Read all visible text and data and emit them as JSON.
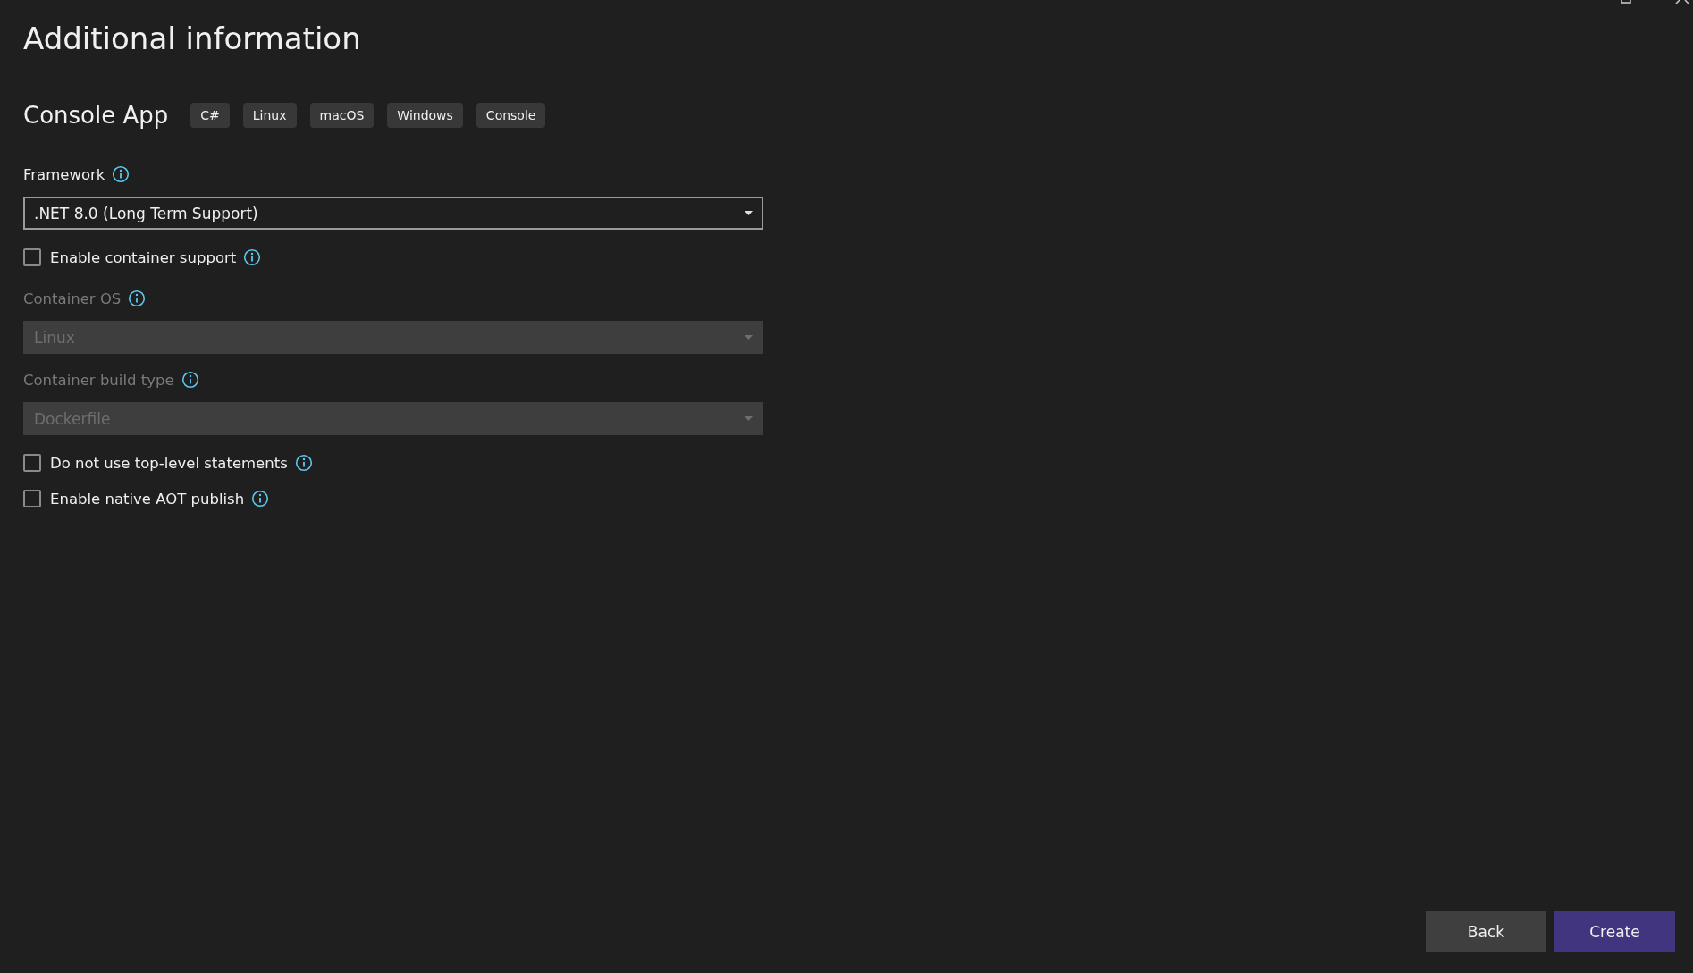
{
  "window": {
    "title": "Additional information"
  },
  "template": {
    "name": "Console App",
    "tags": [
      "C#",
      "Linux",
      "macOS",
      "Windows",
      "Console"
    ]
  },
  "fields": [
    {
      "kind": "dropdown",
      "label": "Framework",
      "value": ".NET 8.0 (Long Term Support)",
      "disabled": false
    },
    {
      "kind": "checkbox",
      "label": "Enable container support",
      "checked": false
    },
    {
      "kind": "dropdown",
      "label": "Container OS",
      "value": "Linux",
      "disabled": true
    },
    {
      "kind": "dropdown",
      "label": "Container build type",
      "value": "Dockerfile",
      "disabled": true
    },
    {
      "kind": "checkbox",
      "label": "Do not use top-level statements",
      "checked": false
    },
    {
      "kind": "checkbox",
      "label": "Enable native AOT publish",
      "checked": false
    }
  ],
  "buttons": [
    {
      "label": "Back",
      "primary": false
    },
    {
      "label": "Create",
      "primary": true
    }
  ]
}
